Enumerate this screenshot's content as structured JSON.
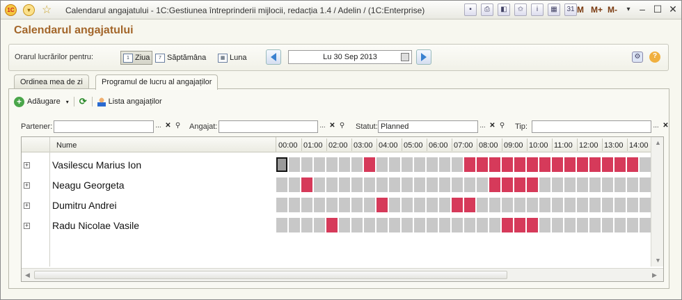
{
  "window": {
    "title": "Calendarul angajatului - 1C:Gestiunea întreprinderii mijlocii, redacția 1.4 / Adelin / (1C:Enterprise)",
    "logo_text": "1C",
    "mem_buttons": [
      "M",
      "M+",
      "M-"
    ]
  },
  "page": {
    "title": "Calendarul angajatului"
  },
  "period": {
    "label": "Orarul lucrărilor pentru:",
    "views": [
      {
        "label": "Ziua",
        "active": true
      },
      {
        "label": "Săptămâna",
        "active": false
      },
      {
        "label": "Luna",
        "active": false
      }
    ],
    "date": "Lu 30 Sep 2013"
  },
  "tabs": [
    "Ordinea mea de zi",
    "Programul de lucru al angajaților"
  ],
  "toolbar": {
    "add": "Adăugare",
    "employees": "Lista angajaților"
  },
  "filters": {
    "partner_label": "Partener:",
    "partner_value": "",
    "employee_label": "Angajat:",
    "employee_value": "",
    "status_label": "Statut:",
    "status_value": "Planned",
    "type_label": "Tip:",
    "type_value": ""
  },
  "grid": {
    "name_header": "Nume",
    "hours": [
      "00:00",
      "01:00",
      "02:00",
      "03:00",
      "04:00",
      "05:00",
      "06:00",
      "07:00",
      "08:00",
      "09:00",
      "10:00",
      "11:00",
      "12:00",
      "13:00",
      "14:00"
    ],
    "rows": [
      {
        "name": "Vasilescu  Marius Ion",
        "busy": [
          7,
          15,
          16,
          17,
          18,
          19,
          20,
          21,
          22,
          23,
          24,
          25,
          26,
          27,
          28
        ],
        "selected": [
          0
        ]
      },
      {
        "name": "Neagu Georgeta",
        "busy": [
          2,
          17,
          18,
          19,
          20
        ],
        "selected": []
      },
      {
        "name": "Dumitru Andrei",
        "busy": [
          8,
          14,
          15
        ],
        "selected": []
      },
      {
        "name": "Radu Nicolae Vasile",
        "busy": [
          4,
          18,
          19,
          20
        ],
        "selected": []
      }
    ]
  },
  "colors": {
    "busy": "#d63a5a",
    "free": "#c8c8c8",
    "title": "#a3662a"
  }
}
